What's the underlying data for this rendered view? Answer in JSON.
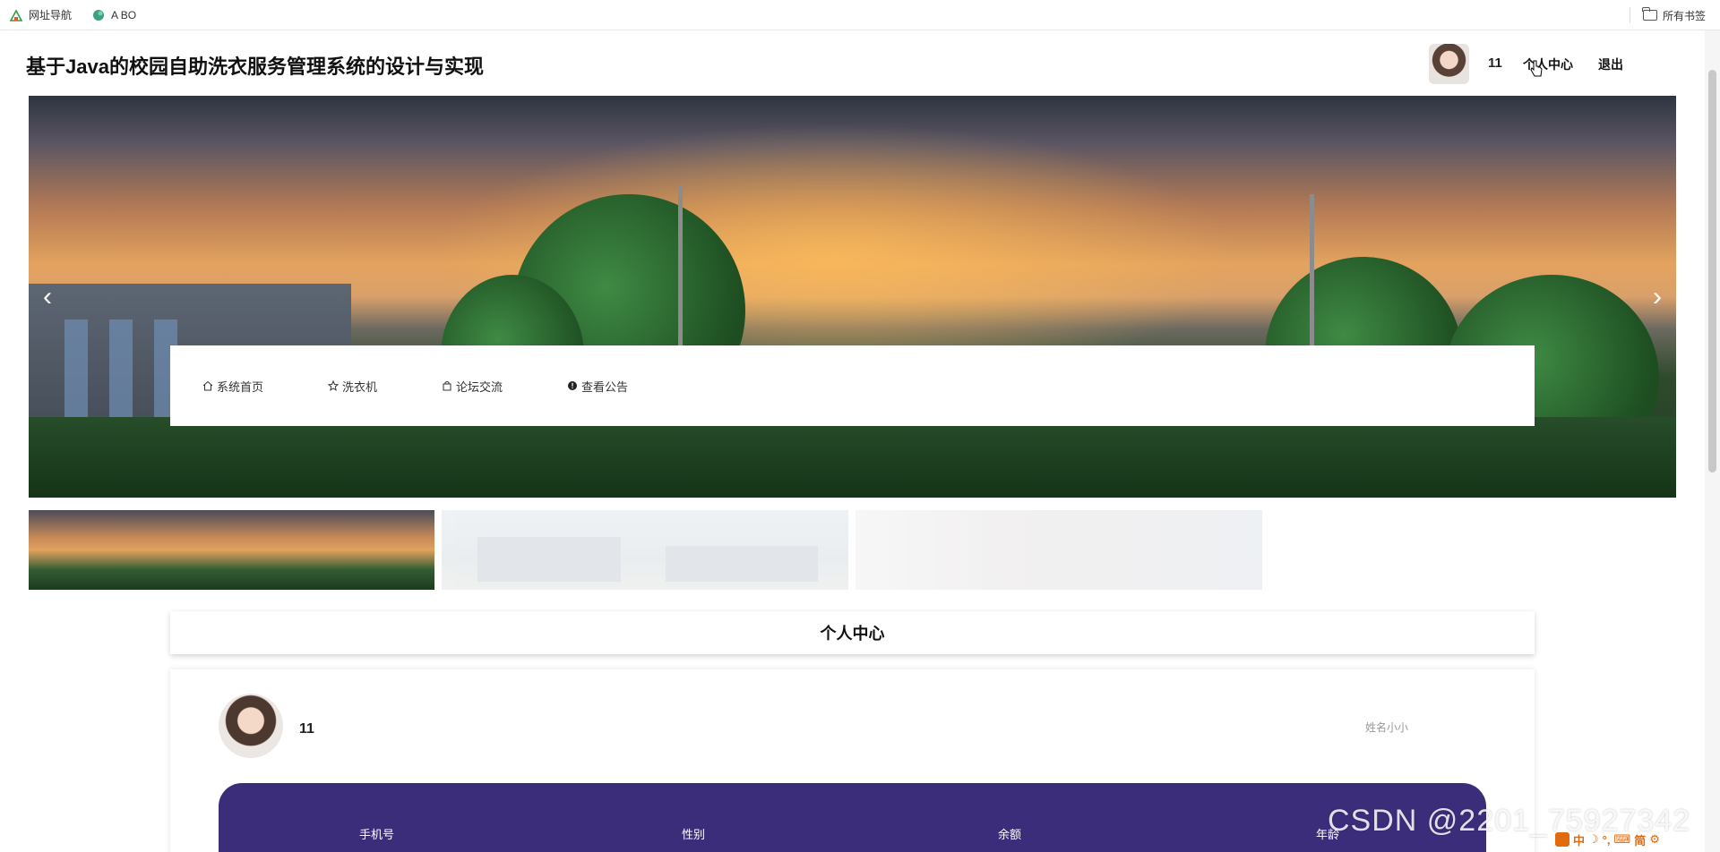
{
  "bookmarks": {
    "items": [
      {
        "label": "网址导航"
      },
      {
        "label": "A BO"
      }
    ],
    "all_bookmarks": "所有书签"
  },
  "header": {
    "title": "基于Java的校园自助洗衣服务管理系统的设计与实现",
    "username": "11",
    "profile_link": "个人中心",
    "logout_link": "退出"
  },
  "carousel": {
    "prev": "‹",
    "next": "›"
  },
  "nav": {
    "items": [
      {
        "label": "系统首页",
        "icon": "home-icon"
      },
      {
        "label": "洗衣机",
        "icon": "star-icon"
      },
      {
        "label": "论坛交流",
        "icon": "bag-icon"
      },
      {
        "label": "查看公告",
        "icon": "info-icon"
      }
    ]
  },
  "profile": {
    "section_title": "个人中心",
    "name": "11",
    "hint": "姓名小小",
    "fields": [
      "手机号",
      "性别",
      "余额",
      "年龄"
    ]
  },
  "watermark": "CSDN @2201_75927342",
  "ime": [
    "中",
    "简"
  ]
}
